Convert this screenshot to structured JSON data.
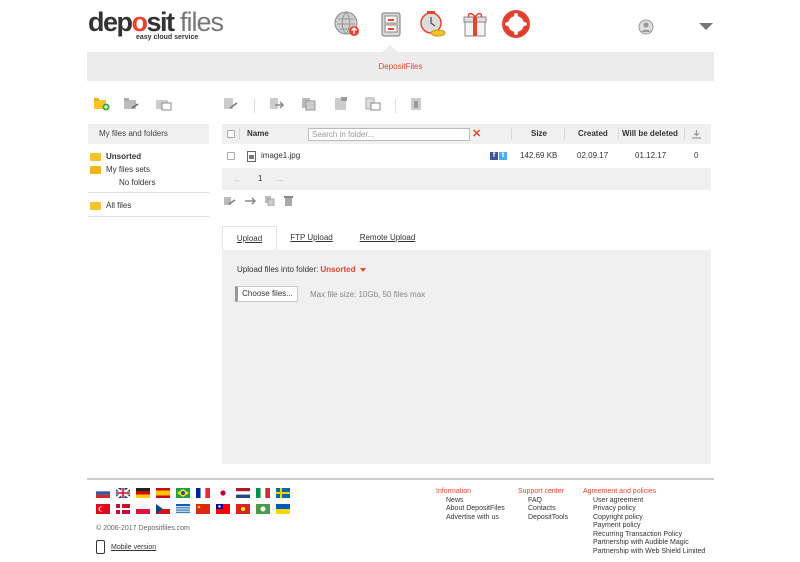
{
  "brand": {
    "logo_part1": "dep",
    "logo_part2": "o",
    "logo_part3": "sit",
    "logo_part4": " files",
    "tagline": "easy cloud service"
  },
  "nav": {
    "icons": [
      "globe-upload-icon",
      "file-cabinet-icon",
      "clock-coins-icon",
      "gift-icon",
      "lifebuoy-icon"
    ],
    "active_index": 1
  },
  "band_title": "DepositFiles",
  "left": {
    "panel_title": "My files and folders",
    "tree": [
      {
        "label": "Unsorted",
        "bold": true
      },
      {
        "label": "My files sets",
        "bold": false
      },
      {
        "label": "No folders",
        "bold": false
      },
      {
        "label": "All files",
        "bold": false
      }
    ]
  },
  "table": {
    "col_name": "Name",
    "search_placeholder": "Search in folder...",
    "col_size": "Size",
    "col_created": "Created",
    "col_deleted": "Will be deleted",
    "rows": [
      {
        "name": "image1.jpg",
        "size": "142.69 KB",
        "created": "02.09.17",
        "deleted": "01.12.17",
        "downloads": "0"
      }
    ]
  },
  "pager": {
    "page": "1",
    "prev": "←",
    "next": "→"
  },
  "upload": {
    "tabs": [
      "Upload",
      "FTP Upload",
      "Remote Upload"
    ],
    "label": "Upload files into folder:",
    "destination": "Unsorted",
    "choose_button": "Choose files...",
    "max_info": "Max file size: 10Gb, 50 files max"
  },
  "footer": {
    "copyright": "© 2006-2017 Depositfiles.com",
    "mobile": "Mobile version",
    "columns": [
      {
        "heading": "Information",
        "items": [
          "News",
          "About DepositFiles",
          "Advertise with us"
        ]
      },
      {
        "heading": "Support center",
        "items": [
          "FAQ",
          "Contacts",
          "DepositTools"
        ]
      },
      {
        "heading": "Agreement and policies",
        "items": [
          "User agreement",
          "Privacy policy",
          "Copyright policy",
          "Payment policy",
          "Recurring Transaction Policy",
          "Partnership with Audible Magic",
          "Partnership with Web Shield Limited"
        ]
      }
    ]
  },
  "colors": {
    "accent": "#e8432e",
    "panel": "#f0f0f0",
    "folder": "#f5c32c"
  }
}
